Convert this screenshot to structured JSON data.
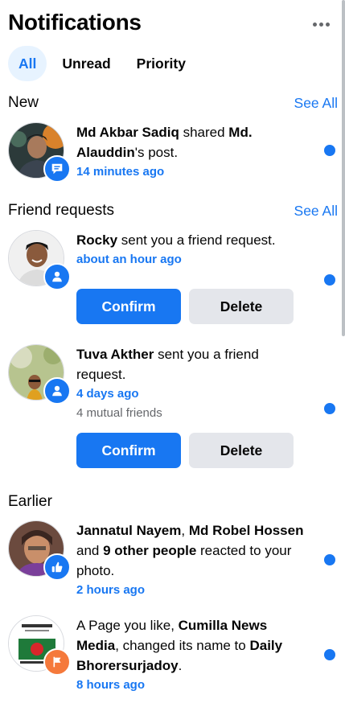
{
  "header": {
    "title": "Notifications",
    "more_icon": "more-horizontal-icon"
  },
  "tabs": [
    {
      "label": "All",
      "active": true
    },
    {
      "label": "Unread",
      "active": false
    },
    {
      "label": "Priority",
      "active": false
    }
  ],
  "sections": {
    "new": {
      "title": "New",
      "see_all": "See All"
    },
    "friend_requests": {
      "title": "Friend requests",
      "see_all": "See All"
    },
    "earlier": {
      "title": "Earlier"
    }
  },
  "notifications": {
    "n1": {
      "name": "Md Akbar Sadiq",
      "text": " shared ",
      "bold2": "Md. Alauddin",
      "text2": "'s post.",
      "time": "14 minutes ago",
      "badge": "comment-icon",
      "unread": true
    },
    "fr1": {
      "name": "Rocky",
      "text": " sent you a friend request.",
      "time": "about an hour ago",
      "badge": "person-icon",
      "confirm": "Confirm",
      "delete": "Delete",
      "unread": true
    },
    "fr2": {
      "name": "Tuva Akther",
      "text": " sent you a friend request.",
      "time": "4 days ago",
      "mutual": "4 mutual friends",
      "badge": "person-icon",
      "confirm": "Confirm",
      "delete": "Delete",
      "unread": true
    },
    "e1": {
      "name": "Jannatul Nayem",
      "text": ", ",
      "bold2": "Md Robel Hossen",
      "text2": " and ",
      "bold3": "9 other people",
      "text3": " reacted to your photo.",
      "time": "2 hours ago",
      "badge": "thumbs-up-icon",
      "unread": true
    },
    "e2": {
      "text": "A Page you like, ",
      "name": "Cumilla News Media",
      "text2": ", changed its name to ",
      "bold3": "Daily Bhorersurjadoy",
      "text3": ".",
      "time": "8 hours ago",
      "badge": "flag-icon",
      "unread": true
    }
  },
  "colors": {
    "accent": "#1877f2",
    "accent_light": "#e7f3ff",
    "flag_badge": "#f5793b",
    "button_gray": "#e4e6eb"
  }
}
